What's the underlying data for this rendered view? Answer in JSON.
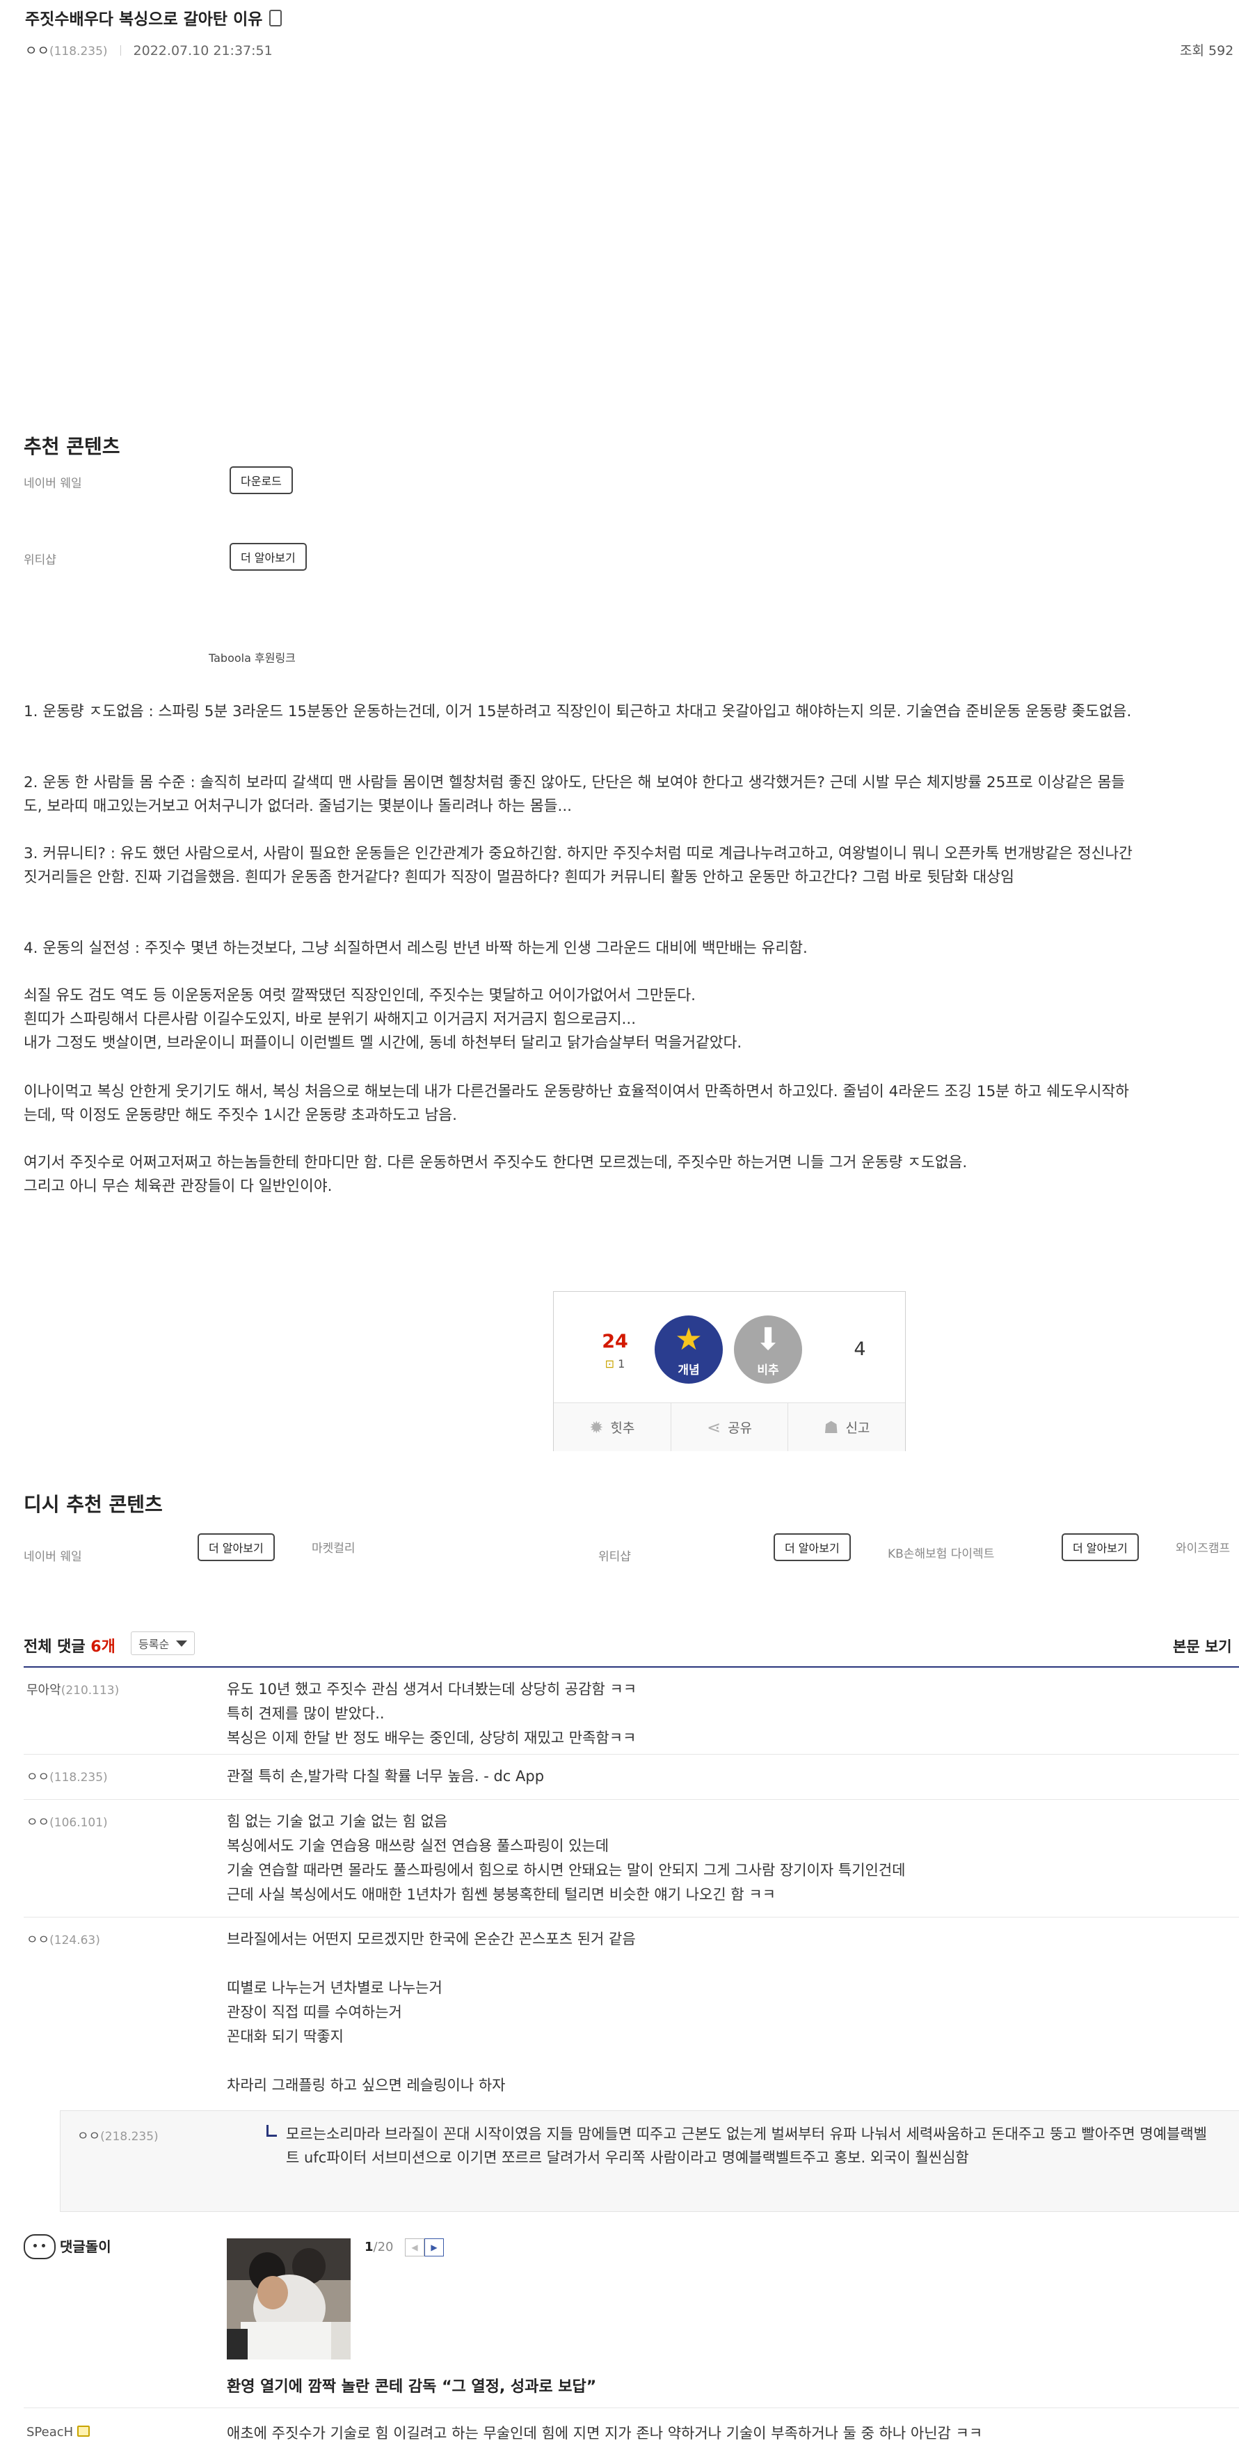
{
  "post": {
    "title": "주짓수배우다 복싱으로 갈아탄 이유",
    "author_nick": "ㅇㅇ",
    "author_ip": "(118.235)",
    "date": "2022.07.10 21:37:51",
    "views": "조회 592"
  },
  "recommended": {
    "heading": "추천 콘텐츠",
    "items": [
      {
        "label": "네이버 웨일",
        "button": "다운로드"
      },
      {
        "label": "위티샵",
        "button": "더 알아보기"
      }
    ],
    "taboola": "Taboola 후원링크"
  },
  "body": {
    "paragraphs": [
      "1. 운동량 ㅈ도없음 : 스파링 5분 3라운드 15분동안 운동하는건데, 이거 15분하려고 직장인이 퇴근하고 차대고 옷갈아입고 해야하는지 의문. 기술연습 준비운동 운동량 좆도없음.",
      "2. 운동 한 사람들 몸 수준 : 솔직히 보라띠 갈색띠 맨 사람들 몸이면 헬창처럼 좋진 않아도, 단단은 해 보여야 한다고 생각했거든? 근데 시발 무슨 체지방률 25프로 이상같은 몸들도, 보라띠 매고있는거보고 어처구니가 없더라. 줄넘기는 몇분이나 돌리려나 하는 몸들...",
      "3. 커뮤니티? : 유도 했던 사람으로서, 사람이 필요한 운동들은 인간관계가 중요하긴함. 하지만 주짓수처럼 띠로 계급나누려고하고, 여왕벌이니 뭐니 오픈카톡 번개방같은 정신나간짓거리들은 안함. 진짜 기겁을했음. 흰띠가 운동좀 한거같다? 흰띠가 직장이 멀끔하다? 흰띠가 커뮤니티 활동 안하고 운동만 하고간다? 그럼 바로 뒷담화 대상임",
      "4. 운동의 실전성 : 주짓수 몇년 하는것보다, 그냥 쇠질하면서 레스링 반년 바짝 하는게 인생 그라운드 대비에 백만배는 유리함.",
      "쇠질 유도 검도 역도 등 이운동저운동 여럿 깔짝댔던 직장인인데, 주짓수는 몇달하고 어이가없어서 그만둔다.\n흰띠가 스파링해서 다른사람 이길수도있지, 바로 분위기 싸해지고 이거금지 저거금지 힘으로금지...\n내가 그정도 뱃살이면, 브라운이니 퍼플이니 이런벨트 멜 시간에, 동네 하천부터 달리고 닭가슴살부터 먹을거같았다.",
      "이나이먹고 복싱 안한게 웃기기도 해서, 복싱 처음으로 해보는데 내가 다른건몰라도 운동량하난 효율적이여서 만족하면서 하고있다. 줄넘이 4라운드 조깅 15분 하고 쉐도우시작하는데, 딱 이정도 운동량만 해도 주짓수 1시간 운동량 초과하도고 남음.",
      "여기서 주짓수로 어쩌고저쩌고 하는놈들한테 한마디만 함. 다른 운동하면서 주짓수도 한다면 모르겠는데, 주짓수만 하는거면 니들 그거 운동량 ㅈ도없음.\n그리고 아니 무슨 체육관 관장들이 다 일반인이야."
    ]
  },
  "vote": {
    "up_count": "24",
    "fix_count": "1",
    "up_label": "개념",
    "down_label": "비추",
    "down_count": "4",
    "actions": [
      "힛추",
      "공유",
      "신고"
    ]
  },
  "recommended2": {
    "heading": "디시 추천 콘텐츠",
    "items": [
      {
        "label": "네이버 웨일",
        "button": "더 알아보기",
        "sub": "마켓컬리"
      },
      {
        "label": "위티샵",
        "button": "더 알아보기",
        "sub": "KB손해보험 다이렉트"
      },
      {
        "label": "",
        "button": "더 알아보기",
        "sub": "와이즈캠프"
      }
    ]
  },
  "comments_header": {
    "label": "전체 댓글",
    "count": "6개",
    "sort": "등록순",
    "body_view": "본문 보기"
  },
  "comments": [
    {
      "nick": "무아악",
      "ip": "(210.113)",
      "text": "유도 10년 했고 주짓수 관심 생겨서 다녀봤는데 상당히 공감함 ㅋㅋ\n특히 견제를 많이 받았다..\n복싱은 이제 한달 반 정도 배우는 중인데, 상당히 재밌고 만족함ㅋㅋ"
    },
    {
      "nick": "ㅇㅇ",
      "ip": "(118.235)",
      "text": "관절 특히 손,발가락 다칠 확률 너무 높음. - dc App"
    },
    {
      "nick": "ㅇㅇ",
      "ip": "(106.101)",
      "text": "힘 없는 기술 없고 기술 없는 힘 없음\n복싱에서도 기술 연습용 매쓰랑 실전 연습용 풀스파링이 있는데\n기술 연습할 때라면 몰라도 풀스파링에서 힘으로 하시면 안돼요는 말이 안되지 그게 그사람 장기이자 특기인건데\n근데 사실 복싱에서도 애매한 1년차가 힘쎈 붕붕혹한테 털리면 비슷한 얘기 나오긴 함 ㅋㅋ"
    },
    {
      "nick": "ㅇㅇ",
      "ip": "(124.63)",
      "text": "브라질에서는 어떤지 모르겠지만 한국에 온순간 꼰스포츠 된거 같음\n\n띠별로 나누는거 년차별로 나누는거\n관장이 직접 띠를 수여하는거\n꼰대화 되기 딱좋지\n\n차라리 그래플링 하고 싶으면 레슬링이나 하자"
    }
  ],
  "reply": {
    "nick": "ㅇㅇ",
    "ip": "(218.235)",
    "text": "모르는소리마라 브라질이 꼰대 시작이였음 지들 맘에들면 띠주고 근본도 없는게 벌써부터 유파 나눠서 세력싸움하고 돈대주고 뚱고 빨아주면 명예블랙벨트 ufc파이터 서브미션으로 이기면 쪼르르 달려가서 우리쪽 사람이라고 명예블랙벨트주고 홍보. 외국이 훨씬심함"
  },
  "dcbot": {
    "name": "댓글돌이",
    "page_current": "1",
    "page_total": "/20",
    "prev": "◀",
    "next": "▶",
    "caption": "환영 열기에 깜짝 놀란 콘테 감독 “그 열정, 성과로 보답”"
  },
  "last_comment": {
    "nick": "SPeacH",
    "text": "애초에 주짓수가 기술로 힘 이길려고 하는 무술인데 힘에 지면 지가 존나 약하거나 기술이 부족하거나 둘 중 하나 아닌감 ㅋㅋ"
  },
  "colors": {
    "accent": "#29367c",
    "up": "#2a3d8f",
    "down": "#a7a7a7",
    "red": "#d31900"
  },
  "icons": {
    "mobile": "mobile-icon",
    "star": "star-icon",
    "thumbs_down": "down-arrow-icon",
    "hit": "hit-icon",
    "share": "share-icon",
    "report": "siren-icon",
    "bot": "bot-face-icon"
  }
}
